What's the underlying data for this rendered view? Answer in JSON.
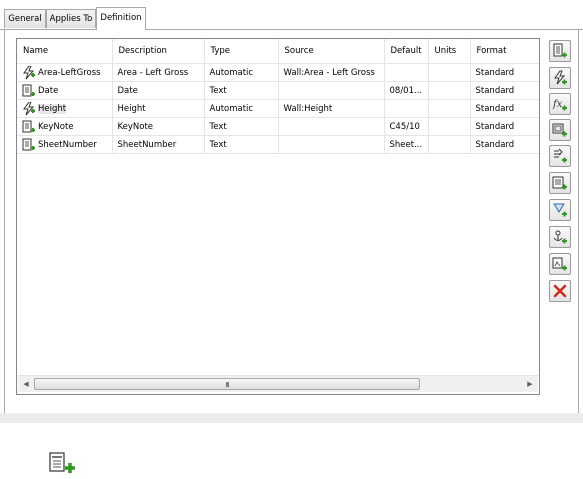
{
  "tabs": [
    {
      "label": "General"
    },
    {
      "label": "Applies To"
    },
    {
      "label": "Definition"
    }
  ],
  "columns": [
    "Name",
    "Description",
    "Type",
    "Source",
    "Default",
    "Units",
    "Format"
  ],
  "rows": [
    {
      "icon": "automatic-property-icon",
      "name": "Area-LeftGross",
      "description": "Area - Left Gross",
      "type": "Automatic",
      "source": "Wall:Area - Left Gross",
      "default": "",
      "units": "",
      "format": "Standard"
    },
    {
      "icon": "manual-property-icon",
      "name": "Date",
      "description": "Date",
      "type": "Text",
      "source": "",
      "default": "08/01...",
      "units": "",
      "format": "Standard"
    },
    {
      "icon": "automatic-property-icon",
      "name": "Height",
      "description": "Height",
      "type": "Automatic",
      "source": "Wall:Height",
      "default": "",
      "units": "",
      "format": "Standard"
    },
    {
      "icon": "manual-property-icon",
      "name": "KeyNote",
      "description": "KeyNote",
      "type": "Text",
      "source": "",
      "default": "C45/10",
      "units": "",
      "format": "Standard"
    },
    {
      "icon": "manual-property-icon",
      "name": "SheetNumber",
      "description": "SheetNumber",
      "type": "Text",
      "source": "",
      "default": "Sheet...",
      "units": "",
      "format": "Standard"
    }
  ],
  "scrollbar": {
    "grip": "III"
  },
  "toolbar": [
    "add-manual-property-icon",
    "add-automatic-property-icon",
    "add-formula-property-icon",
    "add-anchor-property-icon",
    "add-location-property-icon",
    "add-classification-property-icon",
    "add-material-property-icon",
    "add-project-property-icon",
    "add-graphic-property-icon",
    "remove-property-icon"
  ],
  "colors": {
    "accent_green": "#2e9a1e",
    "remove_red": "#d42a1a"
  }
}
